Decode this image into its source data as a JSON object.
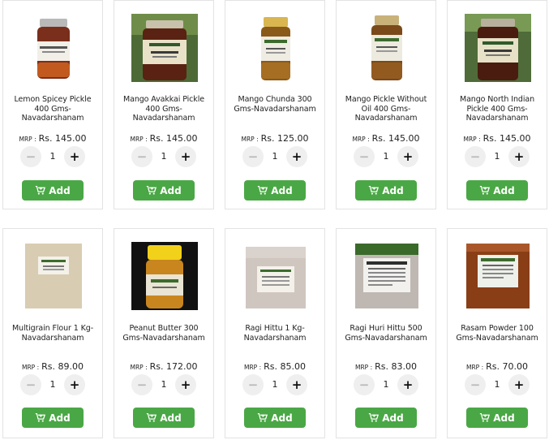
{
  "products": [
    {
      "name": "Lemon Spicey Pickle 400 Gms-Navadarshanam",
      "mrp_label": "MRP :",
      "price": "Rs. 145.00",
      "qty": "1",
      "add_label": "Add",
      "image_icon": "pickle-jar-lemon"
    },
    {
      "name": "Mango Avakkai Pickle 400 Gms-Navadarshanam",
      "mrp_label": "MRP :",
      "price": "Rs. 145.00",
      "qty": "1",
      "add_label": "Add",
      "image_icon": "pickle-jar-avakkai"
    },
    {
      "name": "Mango Chunda 300 Gms-Navadarshanam",
      "mrp_label": "MRP :",
      "price": "Rs. 125.00",
      "qty": "1",
      "add_label": "Add",
      "image_icon": "jar-chunda"
    },
    {
      "name": "Mango Pickle Without Oil 400 Gms-Navadarshanam",
      "mrp_label": "MRP :",
      "price": "Rs. 145.00",
      "qty": "1",
      "add_label": "Add",
      "image_icon": "jar-mango-pickle"
    },
    {
      "name": "Mango North Indian Pickle 400 Gms-Navadarshanam",
      "mrp_label": "MRP :",
      "price": "Rs. 145.00",
      "qty": "1",
      "add_label": "Add",
      "image_icon": "jar-north-indian-pickle"
    },
    {
      "name": "Multigrain Flour 1 Kg-Navadarshanam",
      "mrp_label": "MRP :",
      "price": "Rs. 89.00",
      "qty": "1",
      "add_label": "Add",
      "image_icon": "flour-bag"
    },
    {
      "name": "Peanut Butter 300 Gms-Navadarshanam",
      "mrp_label": "MRP :",
      "price": "Rs. 172.00",
      "qty": "1",
      "add_label": "Add",
      "image_icon": "peanut-butter-jar"
    },
    {
      "name": "Ragi Hittu 1 Kg-Navadarshanam",
      "mrp_label": "MRP :",
      "price": "Rs. 85.00",
      "qty": "1",
      "add_label": "Add",
      "image_icon": "ragi-bag"
    },
    {
      "name": "Ragi Huri Hittu 500 Gms-Navadarshanam",
      "mrp_label": "MRP :",
      "price": "Rs. 83.00",
      "qty": "1",
      "add_label": "Add",
      "image_icon": "ragi-huri-bag"
    },
    {
      "name": "Rasam Powder 100 Gms-Navadarshanam",
      "mrp_label": "MRP :",
      "price": "Rs. 70.00",
      "qty": "1",
      "add_label": "Add",
      "image_icon": "rasam-powder-pack"
    }
  ],
  "controls": {
    "minus_symbol": "−",
    "plus_symbol": "+"
  },
  "colors": {
    "add_button": "#4aa745",
    "card_border": "#e3e3e3",
    "qty_button": "#efefef"
  }
}
